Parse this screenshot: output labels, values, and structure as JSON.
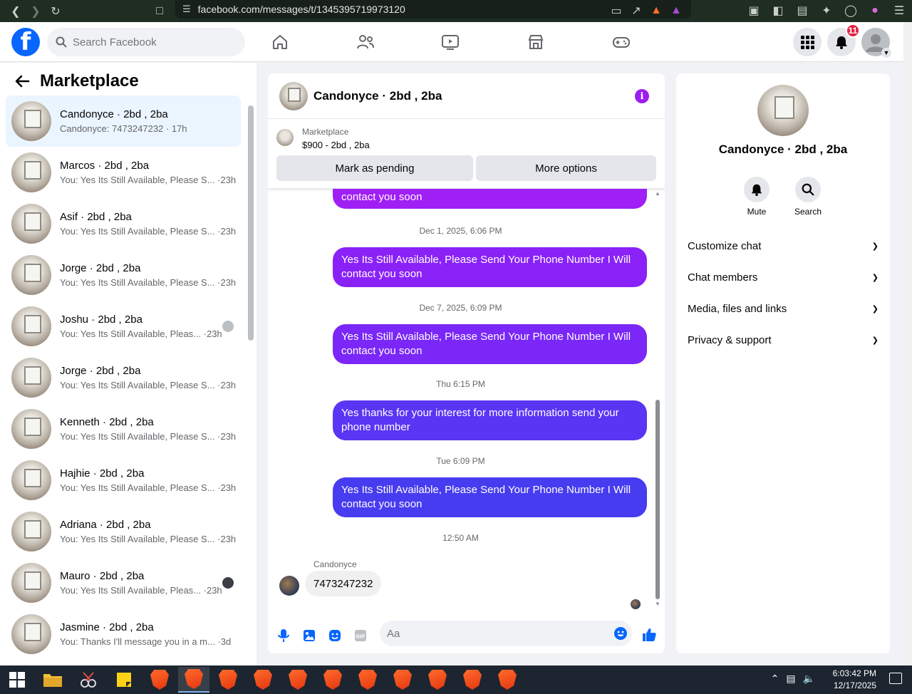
{
  "browser": {
    "url": "facebook.com/messages/t/1345395719973120"
  },
  "header": {
    "search_placeholder": "Search Facebook",
    "notification_count": "11"
  },
  "left": {
    "title": "Marketplace",
    "conversations": [
      {
        "name": "Candonyce · 2bd , 2ba",
        "preview": "Candonyce: 7473247232 · 17h"
      },
      {
        "name": "Marcos · 2bd , 2ba",
        "preview": "You: Yes Its Still Available, Please S... ·23h"
      },
      {
        "name": "Asif · 2bd , 2ba",
        "preview": "You: Yes Its Still Available, Please S... ·23h"
      },
      {
        "name": "Jorge · 2bd , 2ba",
        "preview": "You: Yes Its Still Available, Please S... ·23h"
      },
      {
        "name": "Joshu · 2bd , 2ba",
        "preview": "You: Yes Its Still Available, Pleas... ·23h"
      },
      {
        "name": "Jorge · 2bd , 2ba",
        "preview": "You: Yes Its Still Available, Please S... ·23h"
      },
      {
        "name": "Kenneth · 2bd , 2ba",
        "preview": "You: Yes Its Still Available, Please S... ·23h"
      },
      {
        "name": "Hajhie · 2bd , 2ba",
        "preview": "You: Yes Its Still Available, Please S... ·23h"
      },
      {
        "name": "Adriana · 2bd , 2ba",
        "preview": "You: Yes Its Still Available, Please S... ·23h"
      },
      {
        "name": "Mauro · 2bd , 2ba",
        "preview": "You: Yes Its Still Available, Pleas... ·23h"
      },
      {
        "name": "Jasmine · 2bd , 2ba",
        "preview": "You: Thanks I'll message you in a m... ·3d"
      }
    ]
  },
  "chat": {
    "title": "Candonyce · 2bd , 2ba",
    "listing_label": "Marketplace",
    "listing_price": "$900 - 2bd , 2ba",
    "btn_pending": "Mark as pending",
    "btn_more": "More options",
    "messages": [
      {
        "text": "contact you soon"
      },
      {
        "ts": "Dec 1, 2025, 6:06 PM"
      },
      {
        "text": "Yes Its Still Available, Please Send Your Phone Number I Will contact you soon"
      },
      {
        "ts": "Dec 7, 2025, 6:09 PM"
      },
      {
        "text": "Yes Its Still Available, Please Send Your Phone Number I Will contact you soon"
      },
      {
        "ts": "Thu 6:15 PM"
      },
      {
        "text": "Yes thanks for your interest for more information send your phone number"
      },
      {
        "ts": "Tue 6:09 PM"
      },
      {
        "text": "Yes Its Still Available, Please Send Your Phone Number I Will contact you soon"
      },
      {
        "ts": "12:50 AM"
      }
    ],
    "received_name": "Candonyce",
    "received_text": "7473247232",
    "composer_placeholder": "Aa",
    "bubble_colors": [
      "#a01ff5",
      "#8a22f7",
      "#7a27f7",
      "#5a35f4",
      "#473cf0"
    ]
  },
  "right": {
    "name": "Candonyce · 2bd , 2ba",
    "mute_label": "Mute",
    "search_label": "Search",
    "sections": [
      "Customize chat",
      "Chat members",
      "Media, files and links",
      "Privacy & support"
    ]
  },
  "taskbar": {
    "time": "6:03:42 PM",
    "date": "12/17/2025"
  }
}
